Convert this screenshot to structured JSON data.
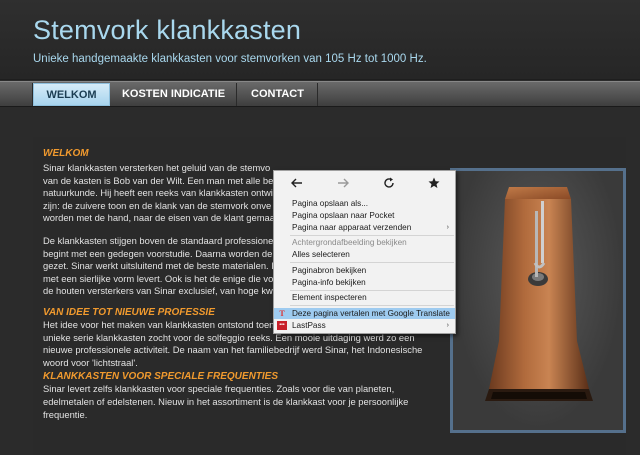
{
  "header": {
    "title": "Stemvork klankkasten",
    "subtitle": "Unieke handgemaakte klankkasten voor stemvorken van 105 Hz tot 1000 Hz."
  },
  "nav": {
    "items": [
      {
        "label": "WELKOM",
        "active": true
      },
      {
        "label": "KOSTEN INDICATIE",
        "active": false
      },
      {
        "label": "CONTACT",
        "active": false
      }
    ]
  },
  "content": {
    "heading": "WELKOM",
    "paragraph1": [
      "Sinar klankkasten versterken het geluid van de stemvo",
      "van de kasten is Bob van der Wilt. Een man met alle be",
      "natuurkunde. Hij heeft een reeks van klankkasten ontwi",
      "zijn: de zuivere toon en de klank van de stemvork onve",
      "worden met de hand, naar de eisen van de klant gemaa"
    ],
    "paragraph2": [
      "De klankkasten stijgen boven de standaard professione",
      "begint met een gedegen voorstudie. Daarna worden de",
      "gezet. Sinar werkt uitsluitend met de beste materialen. I",
      "met een sierlijke vorm levert. Ook is het de enige die vo",
      "de houten versterkers van Sinar exclusief, van hoge kw"
    ],
    "section2_heading": "VAN IDEE TOT NIEUWE PROFESSIE",
    "section2_text": [
      "Het idee voor het maken van klankkasten ontstond toen spiritueel academie Noorderlicht een",
      "unieke serie klankkasten zocht voor de solfeggio reeks. Een mooie uitdaging werd zo een",
      "nieuwe professionele activiteit. De naam van het familiebedrijf werd Sinar, het Indonesische",
      "woord voor 'lichtstraal'."
    ],
    "section3_heading": "KLANKKASTEN VOOR SPECIALE FREQUENTIES",
    "section3_text": [
      "Sinar levert zelfs klankkasten voor speciale frequenties. Zoals voor die van planeten,",
      "edelmetalen of edelstenen. Nieuw in het assortiment is de klankkast voor je persoonlijke",
      "frequentie."
    ]
  },
  "context_menu": {
    "toolbar": [
      "back-icon",
      "forward-icon",
      "reload-icon",
      "bookmark-star-icon"
    ],
    "items": [
      {
        "label": "Pagina opslaan als...",
        "disabled": false,
        "submenu": false
      },
      {
        "label": "Pagina opslaan naar Pocket",
        "disabled": false,
        "submenu": false
      },
      {
        "label": "Pagina naar apparaat verzenden",
        "disabled": false,
        "submenu": true
      },
      {
        "label": "Achtergrondafbeelding bekijken",
        "disabled": true,
        "submenu": false
      },
      {
        "label": "Alles selecteren",
        "disabled": false,
        "submenu": false
      },
      {
        "label": "Paginabron bekijken",
        "disabled": false,
        "submenu": false
      },
      {
        "label": "Pagina-info bekijken",
        "disabled": false,
        "submenu": false
      },
      {
        "label": "Element inspecteren",
        "disabled": false,
        "submenu": false
      },
      {
        "label": "Deze pagina vertalen met Google Translate",
        "disabled": false,
        "submenu": false,
        "highlight": true
      },
      {
        "label": "LastPass",
        "disabled": false,
        "submenu": true
      }
    ]
  },
  "colors": {
    "title": "#a9d8ee",
    "heading_orange": "#f19a2e",
    "nav_active": "#a8d4ee",
    "menu_highlight": "#9ecbf0"
  }
}
